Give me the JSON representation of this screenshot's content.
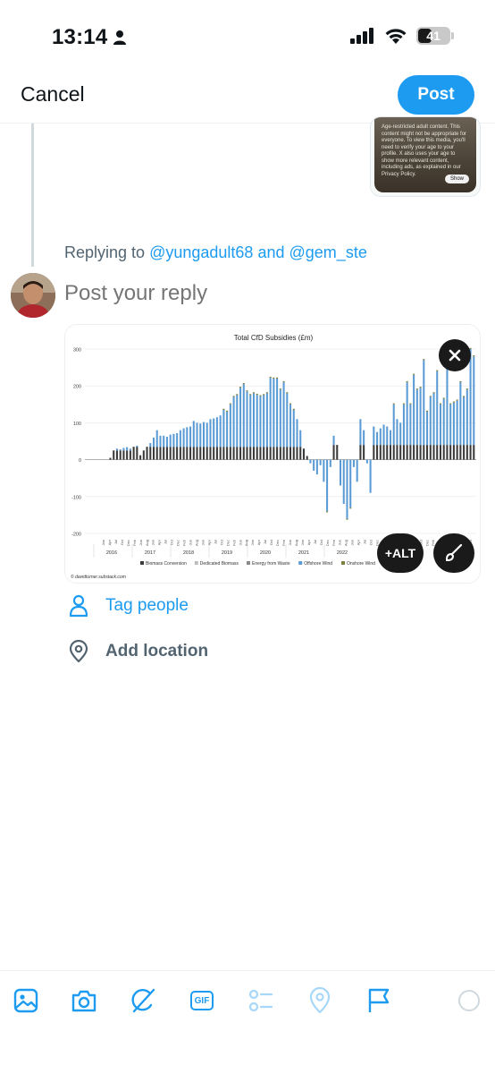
{
  "status_bar": {
    "time": "13:14",
    "battery": "41"
  },
  "header": {
    "cancel_label": "Cancel",
    "post_label": "Post"
  },
  "quoted_media": {
    "warning_text": "Age-restricted adult content. This content might not be appropriate for everyone. To view this media, you'll need to verify your age to your profile. X also uses your age to show more relevant content, including ads, as explained in our Privacy Policy.",
    "show_label": "Show"
  },
  "reply": {
    "prefix": "Replying to",
    "mention_1": "@yungadult68",
    "conjunction": "and",
    "mention_2": "@gem_ste",
    "placeholder": "Post your reply"
  },
  "attachment": {
    "alt_label": "+ALT",
    "credit": "© davidturner.substack.com"
  },
  "chart_data": {
    "type": "bar",
    "title": "Total CfD Subsidies (£m)",
    "ylim": [
      -200,
      300
    ],
    "yticks": [
      "300",
      "200",
      "100",
      "0",
      "-100",
      "-200"
    ],
    "years": [
      "2016",
      "2017",
      "2018",
      "2019",
      "2020",
      "2021",
      "2022"
    ],
    "legend": [
      "Biomass Conversion",
      "Dedicated Biomass",
      "Energy from Waste",
      "Offshore Wind",
      "Onshore Wind"
    ],
    "series_colors": [
      "#3a3a3a",
      "#bdbdbd",
      "#8a8a8a",
      "#5b9bd5",
      "#7f7f3f"
    ],
    "values": [
      0,
      0,
      5,
      25,
      30,
      28,
      32,
      34,
      30,
      35,
      38,
      12,
      25,
      35,
      45,
      60,
      80,
      65,
      65,
      62,
      68,
      70,
      72,
      80,
      85,
      88,
      90,
      105,
      100,
      98,
      102,
      100,
      110,
      112,
      115,
      120,
      135,
      130,
      150,
      170,
      175,
      195,
      205,
      185,
      175,
      180,
      176,
      172,
      175,
      180,
      222,
      220,
      220,
      190,
      210,
      180,
      150,
      135,
      110,
      80,
      30,
      10,
      -10,
      -30,
      -40,
      -15,
      -60,
      -140,
      -20,
      65,
      40,
      -70,
      -120,
      -160,
      -130,
      -20,
      -60,
      110,
      80,
      -10,
      -90,
      90,
      75,
      85,
      95,
      90,
      80,
      150,
      110,
      100,
      150,
      210,
      150,
      230,
      190,
      195,
      270,
      130,
      170,
      180,
      240,
      150,
      165,
      255,
      150,
      155,
      160,
      210,
      170,
      190,
      300,
      280
    ]
  },
  "options": {
    "tag_people": "Tag people",
    "add_location": "Add location"
  },
  "toolbar": {
    "gif_label": "GIF"
  }
}
